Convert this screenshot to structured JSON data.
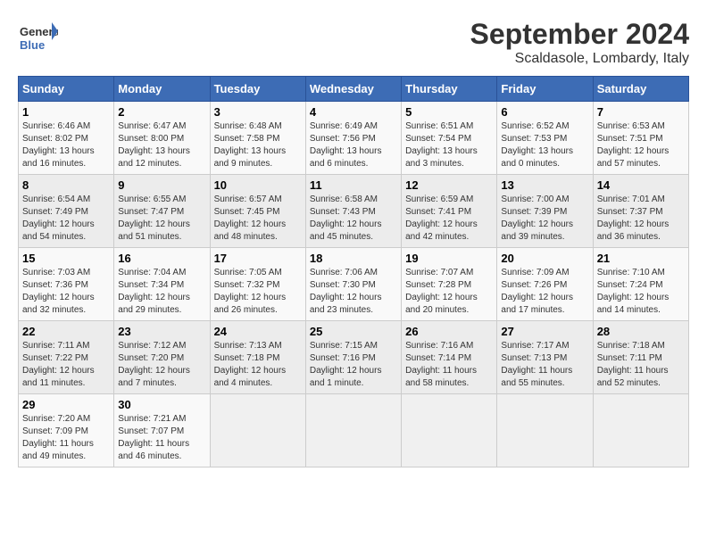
{
  "header": {
    "logo_text_general": "General",
    "logo_text_blue": "Blue",
    "title": "September 2024",
    "subtitle": "Scaldasole, Lombardy, Italy"
  },
  "calendar": {
    "days_of_week": [
      "Sunday",
      "Monday",
      "Tuesday",
      "Wednesday",
      "Thursday",
      "Friday",
      "Saturday"
    ],
    "weeks": [
      [
        null,
        null,
        null,
        null,
        null,
        null,
        null,
        {
          "day": "1",
          "col": 0,
          "info": "Sunrise: 6:46 AM\nSunset: 8:02 PM\nDaylight: 13 hours\nand 16 minutes."
        },
        {
          "day": "2",
          "col": 1,
          "info": "Sunrise: 6:47 AM\nSunset: 8:00 PM\nDaylight: 13 hours\nand 12 minutes."
        },
        {
          "day": "3",
          "col": 2,
          "info": "Sunrise: 6:48 AM\nSunset: 7:58 PM\nDaylight: 13 hours\nand 9 minutes."
        },
        {
          "day": "4",
          "col": 3,
          "info": "Sunrise: 6:49 AM\nSunset: 7:56 PM\nDaylight: 13 hours\nand 6 minutes."
        },
        {
          "day": "5",
          "col": 4,
          "info": "Sunrise: 6:51 AM\nSunset: 7:54 PM\nDaylight: 13 hours\nand 3 minutes."
        },
        {
          "day": "6",
          "col": 5,
          "info": "Sunrise: 6:52 AM\nSunset: 7:53 PM\nDaylight: 13 hours\nand 0 minutes."
        },
        {
          "day": "7",
          "col": 6,
          "info": "Sunrise: 6:53 AM\nSunset: 7:51 PM\nDaylight: 12 hours\nand 57 minutes."
        }
      ],
      [
        {
          "day": "8",
          "col": 0,
          "info": "Sunrise: 6:54 AM\nSunset: 7:49 PM\nDaylight: 12 hours\nand 54 minutes."
        },
        {
          "day": "9",
          "col": 1,
          "info": "Sunrise: 6:55 AM\nSunset: 7:47 PM\nDaylight: 12 hours\nand 51 minutes."
        },
        {
          "day": "10",
          "col": 2,
          "info": "Sunrise: 6:57 AM\nSunset: 7:45 PM\nDaylight: 12 hours\nand 48 minutes."
        },
        {
          "day": "11",
          "col": 3,
          "info": "Sunrise: 6:58 AM\nSunset: 7:43 PM\nDaylight: 12 hours\nand 45 minutes."
        },
        {
          "day": "12",
          "col": 4,
          "info": "Sunrise: 6:59 AM\nSunset: 7:41 PM\nDaylight: 12 hours\nand 42 minutes."
        },
        {
          "day": "13",
          "col": 5,
          "info": "Sunrise: 7:00 AM\nSunset: 7:39 PM\nDaylight: 12 hours\nand 39 minutes."
        },
        {
          "day": "14",
          "col": 6,
          "info": "Sunrise: 7:01 AM\nSunset: 7:37 PM\nDaylight: 12 hours\nand 36 minutes."
        }
      ],
      [
        {
          "day": "15",
          "col": 0,
          "info": "Sunrise: 7:03 AM\nSunset: 7:36 PM\nDaylight: 12 hours\nand 32 minutes."
        },
        {
          "day": "16",
          "col": 1,
          "info": "Sunrise: 7:04 AM\nSunset: 7:34 PM\nDaylight: 12 hours\nand 29 minutes."
        },
        {
          "day": "17",
          "col": 2,
          "info": "Sunrise: 7:05 AM\nSunset: 7:32 PM\nDaylight: 12 hours\nand 26 minutes."
        },
        {
          "day": "18",
          "col": 3,
          "info": "Sunrise: 7:06 AM\nSunset: 7:30 PM\nDaylight: 12 hours\nand 23 minutes."
        },
        {
          "day": "19",
          "col": 4,
          "info": "Sunrise: 7:07 AM\nSunset: 7:28 PM\nDaylight: 12 hours\nand 20 minutes."
        },
        {
          "day": "20",
          "col": 5,
          "info": "Sunrise: 7:09 AM\nSunset: 7:26 PM\nDaylight: 12 hours\nand 17 minutes."
        },
        {
          "day": "21",
          "col": 6,
          "info": "Sunrise: 7:10 AM\nSunset: 7:24 PM\nDaylight: 12 hours\nand 14 minutes."
        }
      ],
      [
        {
          "day": "22",
          "col": 0,
          "info": "Sunrise: 7:11 AM\nSunset: 7:22 PM\nDaylight: 12 hours\nand 11 minutes."
        },
        {
          "day": "23",
          "col": 1,
          "info": "Sunrise: 7:12 AM\nSunset: 7:20 PM\nDaylight: 12 hours\nand 7 minutes."
        },
        {
          "day": "24",
          "col": 2,
          "info": "Sunrise: 7:13 AM\nSunset: 7:18 PM\nDaylight: 12 hours\nand 4 minutes."
        },
        {
          "day": "25",
          "col": 3,
          "info": "Sunrise: 7:15 AM\nSunset: 7:16 PM\nDaylight: 12 hours\nand 1 minute."
        },
        {
          "day": "26",
          "col": 4,
          "info": "Sunrise: 7:16 AM\nSunset: 7:14 PM\nDaylight: 11 hours\nand 58 minutes."
        },
        {
          "day": "27",
          "col": 5,
          "info": "Sunrise: 7:17 AM\nSunset: 7:13 PM\nDaylight: 11 hours\nand 55 minutes."
        },
        {
          "day": "28",
          "col": 6,
          "info": "Sunrise: 7:18 AM\nSunset: 7:11 PM\nDaylight: 11 hours\nand 52 minutes."
        }
      ],
      [
        {
          "day": "29",
          "col": 0,
          "info": "Sunrise: 7:20 AM\nSunset: 7:09 PM\nDaylight: 11 hours\nand 49 minutes."
        },
        {
          "day": "30",
          "col": 1,
          "info": "Sunrise: 7:21 AM\nSunset: 7:07 PM\nDaylight: 11 hours\nand 46 minutes."
        }
      ]
    ]
  }
}
